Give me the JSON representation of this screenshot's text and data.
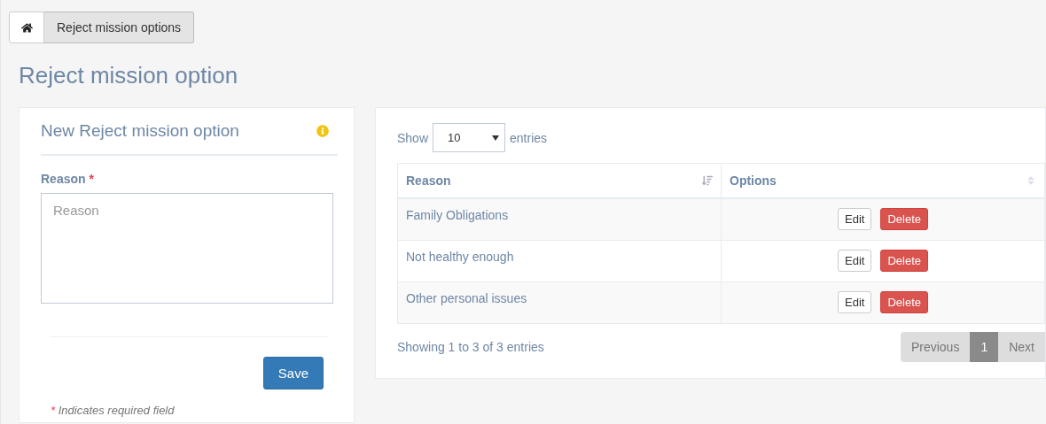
{
  "breadcrumb": [
    {
      "kind": "home"
    },
    {
      "kind": "page",
      "label": "Reject mission options"
    }
  ],
  "title": "Reject mission option",
  "form": {
    "title": "New Reject mission option",
    "field": {
      "label": "Reason",
      "required": true,
      "required_mark": "*",
      "placeholder": "Reason"
    },
    "button": "Save",
    "note_mark": "*",
    "note": "Indicates required field"
  },
  "table": {
    "length": {
      "before": "Show",
      "value": "10",
      "after": "entries"
    },
    "columns": [
      {
        "label": "Reason",
        "sorted": true
      },
      {
        "label": "Options",
        "sorted": false
      }
    ],
    "rows": [
      {
        "reason": "Family Obligations",
        "actions": [
          "Edit",
          "Delete"
        ]
      },
      {
        "reason": "Not healthy enough",
        "actions": [
          "Edit",
          "Delete"
        ]
      },
      {
        "reason": "Other personal issues",
        "actions": [
          "Edit",
          "Delete"
        ]
      }
    ],
    "info": "Showing 1 to 3 of 3 entries",
    "pagination": [
      {
        "label": "Previous",
        "selected": false
      },
      {
        "label": "1",
        "selected": true
      },
      {
        "label": "Next",
        "selected": false
      }
    ]
  }
}
